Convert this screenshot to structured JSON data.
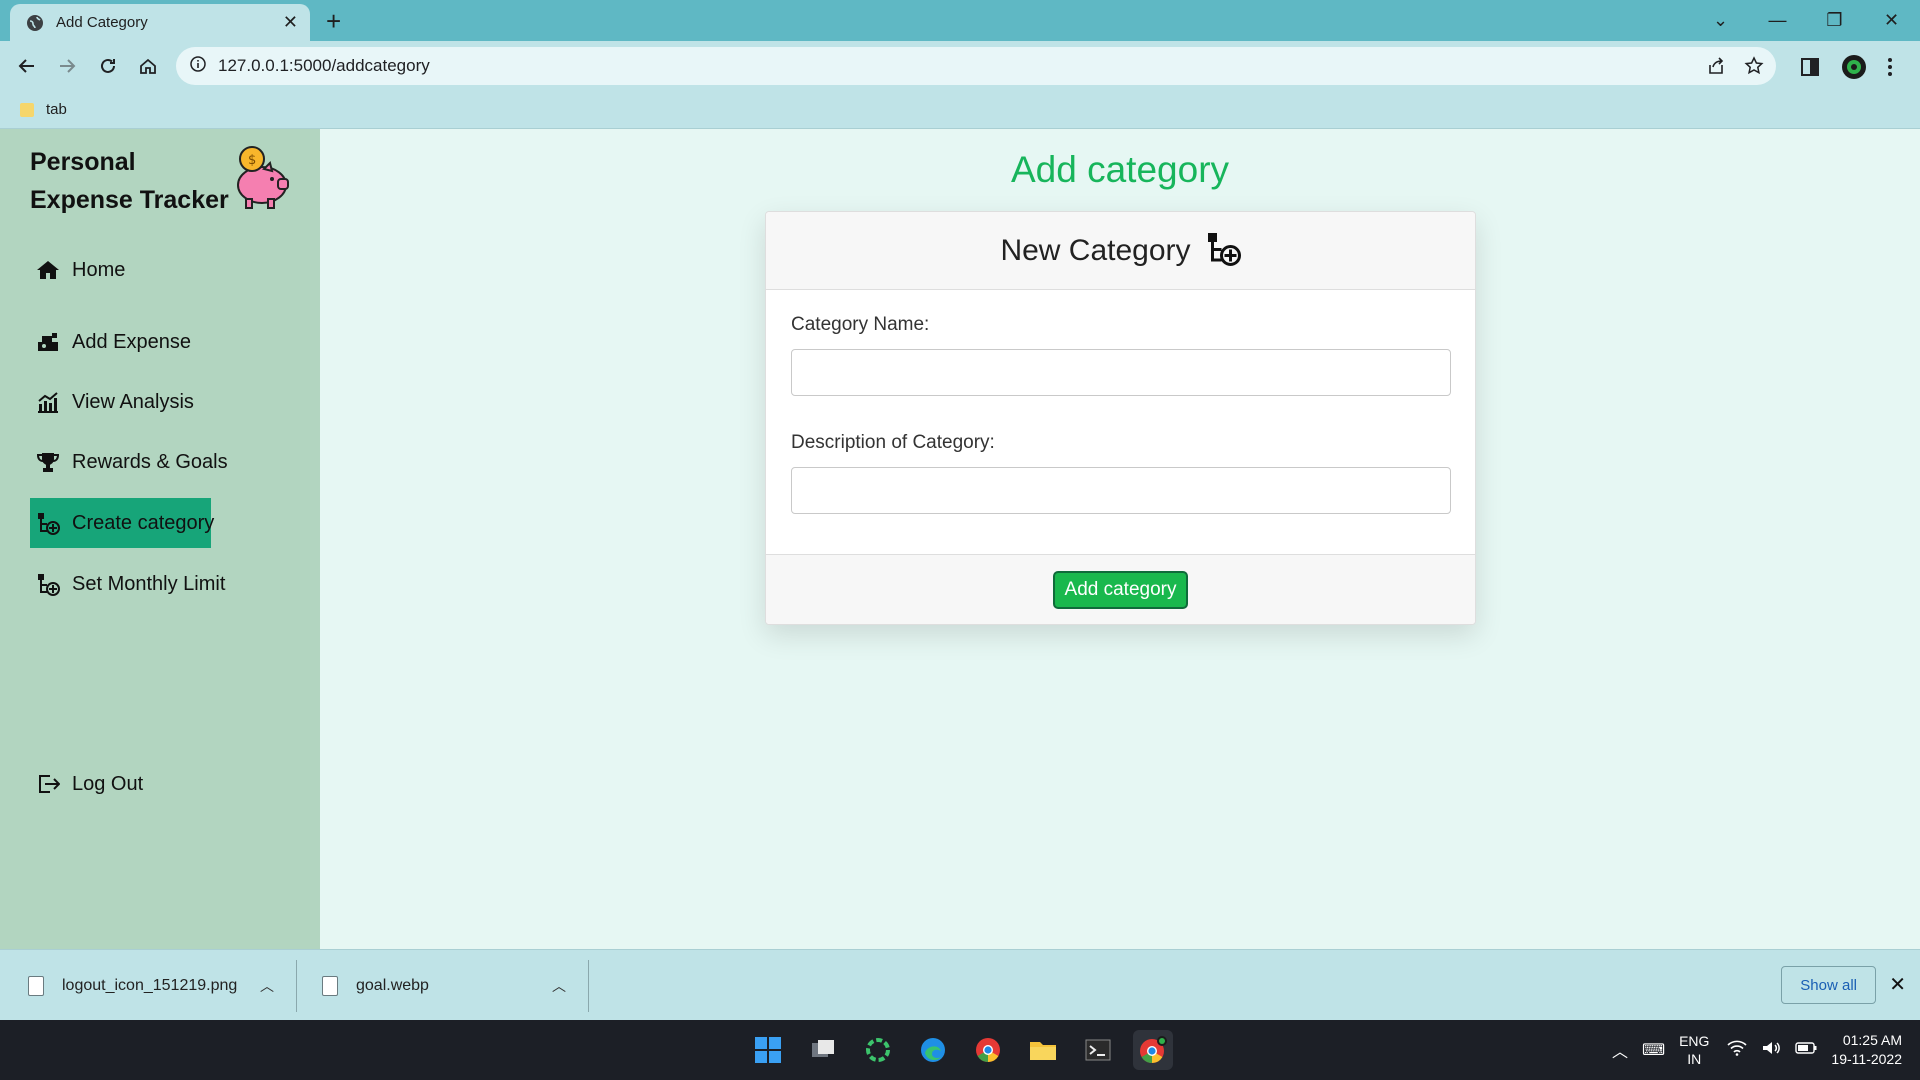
{
  "browser": {
    "tab_title": "Add Category",
    "url": "127.0.0.1:5000/addcategory",
    "bookmark": "tab"
  },
  "sidebar": {
    "brand": "Personal Expense Tracker",
    "items": [
      {
        "label": "Home",
        "icon": "home-icon"
      },
      {
        "label": "Add Expense",
        "icon": "add-expense-icon"
      },
      {
        "label": "View Analysis",
        "icon": "chart-icon"
      },
      {
        "label": "Rewards & Goals",
        "icon": "trophy-icon"
      },
      {
        "label": "Create category",
        "icon": "category-add-icon",
        "active": true
      },
      {
        "label": "Set Monthly Limit",
        "icon": "category-add-icon"
      }
    ],
    "logout": "Log Out"
  },
  "main": {
    "title": "Add category",
    "card": {
      "header": "New Category",
      "name_label": "Category Name:",
      "name_value": "",
      "desc_label": "Description of Category:",
      "desc_value": "",
      "submit": "Add category"
    }
  },
  "downloads": {
    "items": [
      "logout_icon_151219.png",
      "goal.webp"
    ],
    "show_all": "Show all"
  },
  "taskbar": {
    "lang_1": "ENG",
    "lang_2": "IN",
    "time": "01:25 AM",
    "date": "19-11-2022"
  },
  "colors": {
    "accent_green": "#17b55b",
    "active_nav": "#17a579",
    "sidebar_bg": "#b2d5c0",
    "chrome_bg": "#5fb8c4"
  }
}
